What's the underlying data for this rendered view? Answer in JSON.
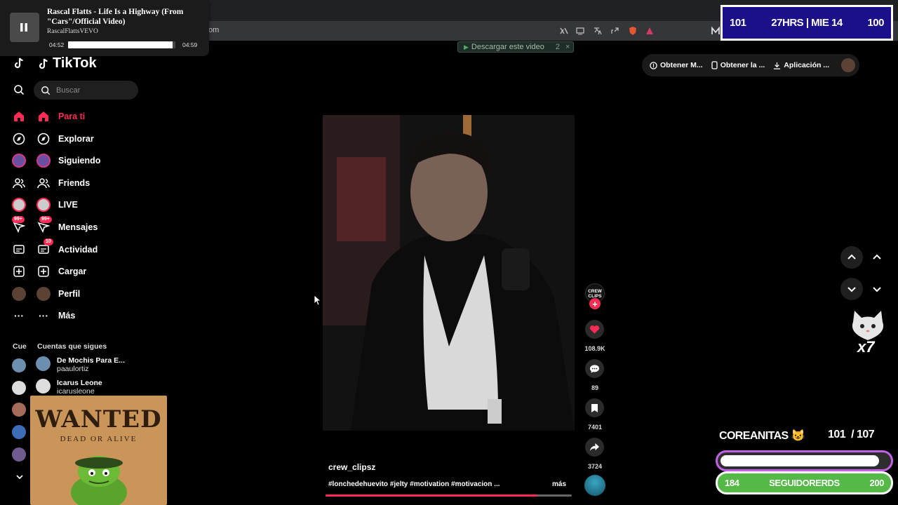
{
  "browser": {
    "address": "om",
    "download_button": "Descargar este video",
    "download_count": "2"
  },
  "media": {
    "title": "Rascal Flatts - Life Is a Highway (From \"Cars\"/Official Video)",
    "artist": "RascalFlattsVEVO",
    "elapsed": "04:52",
    "duration": "04:59",
    "progress": 0.976
  },
  "stream_overlay": {
    "score_left": "101",
    "score_center": "27HRS | MIE 14",
    "score_right": "100",
    "goal_label": "COREANITAS",
    "goal_current": "101",
    "goal_total": "/ 107",
    "goal_progress": 0.944,
    "followers_start": "184",
    "followers_label": "SEGUIDORERDS",
    "followers_end": "200",
    "combo": "x7",
    "wanted_title": "WANTED",
    "wanted_subtitle": "DEAD OR ALIVE"
  },
  "tiktok": {
    "brand": "TikTok",
    "search_placeholder": "Buscar",
    "nav": [
      {
        "label": "Para ti",
        "icon": "home-icon"
      },
      {
        "label": "Explorar",
        "icon": "compass-icon"
      },
      {
        "label": "Siguiendo",
        "icon": "following-avatar-icon"
      },
      {
        "label": "Friends",
        "icon": "friends-icon"
      },
      {
        "label": "LIVE",
        "icon": "live-avatar-icon"
      },
      {
        "label": "Mensajes",
        "icon": "messages-icon",
        "badge": "99+"
      },
      {
        "label": "Actividad",
        "icon": "activity-icon",
        "badge": "10"
      },
      {
        "label": "Cargar",
        "icon": "upload-icon"
      },
      {
        "label": "Perfil",
        "icon": "profile-avatar-icon"
      },
      {
        "label": "Más",
        "icon": "more-dots-icon"
      }
    ],
    "following_title": "Cuentas que sigues",
    "following_title_collapsed": "Cue",
    "accounts": [
      {
        "name": "De Mochis Para E...",
        "user": "paaulortiz"
      },
      {
        "name": "Icarus Leone",
        "user": "icarusleone"
      }
    ],
    "top_menu": [
      "Obtener M...",
      "Obtener la ...",
      "Aplicación ..."
    ],
    "video": {
      "creator": "crew_clipsz",
      "caption": "#lonchedehuevito #jelty #motivation #motivacion ...",
      "more": "más",
      "progress": 0.86,
      "creator_badge": "CREW CLIPS",
      "likes": "108.9K",
      "comments": "89",
      "saves": "7401",
      "shares": "3724"
    }
  },
  "colors": {
    "accent": "#fe2c55",
    "score_bg": "#1b0f8a",
    "goal_border": "#c261e8",
    "followers_bar": "#54b947"
  }
}
